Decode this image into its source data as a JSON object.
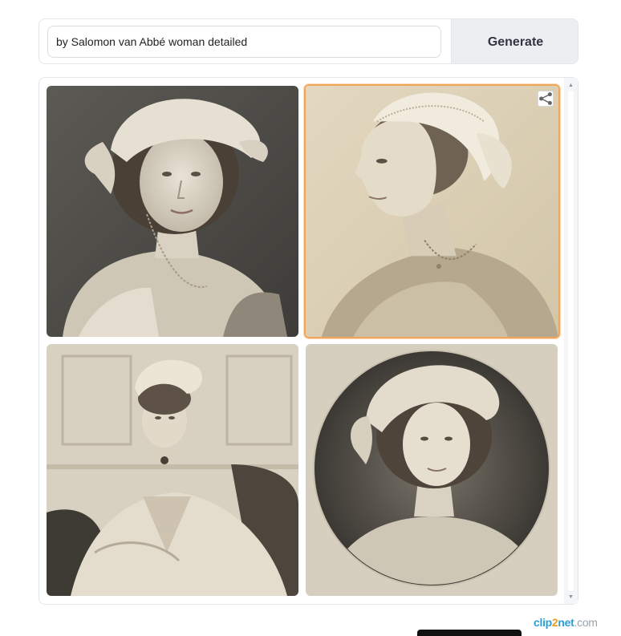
{
  "prompt": {
    "value": "by Salomon van Abbé woman detailed",
    "button_label": "Generate"
  },
  "gallery": {
    "images": [
      {
        "name": "portrait-woman-turban-dark-background",
        "selected": false
      },
      {
        "name": "portrait-woman-profile-lace-cap",
        "selected": true
      },
      {
        "name": "portrait-woman-seated-gown",
        "selected": false
      },
      {
        "name": "portrait-woman-circular-frame",
        "selected": false
      }
    ],
    "share_icon": "share-icon"
  },
  "scrollbar": {
    "up_glyph": "▲",
    "down_glyph": "▼"
  },
  "watermark": {
    "part1": "clip",
    "part2": "2",
    "part3": "net",
    "part4": ".com"
  },
  "colors": {
    "selected_border": "#f0a55a",
    "button_bg": "#eceef2"
  }
}
